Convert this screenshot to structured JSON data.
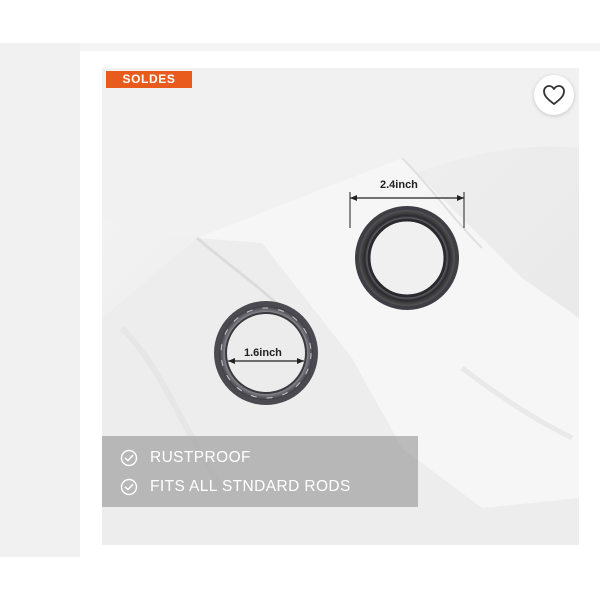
{
  "badge": {
    "label": "SOLDES",
    "color": "#e95b1d"
  },
  "favorite": {
    "icon": "heart-outline-icon"
  },
  "image": {
    "large_ring": {
      "dimension_label": "2.4inch"
    },
    "small_ring": {
      "dimension_label": "1.6inch"
    }
  },
  "features": [
    {
      "icon": "check-circle-icon",
      "label": "RUSTPROOF"
    },
    {
      "icon": "check-circle-icon",
      "label": "FITS ALL STNDARD RODS"
    }
  ]
}
